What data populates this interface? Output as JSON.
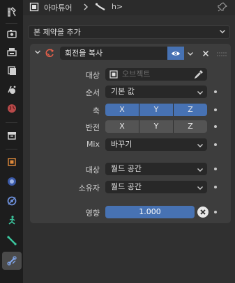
{
  "header": {
    "object_name": "아마튜어",
    "bone_name": "h>"
  },
  "add_constraint": {
    "label": "본 제약을 추가"
  },
  "constraint": {
    "name": "회전을 복사",
    "rows": {
      "target": {
        "label": "대상",
        "placeholder": "오브젝트"
      },
      "order": {
        "label": "순서",
        "value": "기본 값"
      },
      "axis": {
        "label": "축",
        "buttons": [
          "X",
          "Y",
          "Z"
        ]
      },
      "invert": {
        "label": "반전",
        "buttons": [
          "X",
          "Y",
          "Z"
        ]
      },
      "mix": {
        "label": "Mix",
        "value": "바꾸기"
      },
      "target_space": {
        "label": "대상",
        "value": "월드 공간"
      },
      "owner_space": {
        "label": "소유자",
        "value": "월드 공간"
      },
      "influence": {
        "label": "영향",
        "value": "1.000"
      }
    }
  },
  "colors": {
    "accent": "#4772b3",
    "constraint_icon": "#e8604a"
  },
  "tabs": [
    {
      "icon": "tool-icon"
    },
    {
      "icon": "render-icon"
    },
    {
      "icon": "output-icon"
    },
    {
      "icon": "view-layer-icon"
    },
    {
      "icon": "scene-icon"
    },
    {
      "icon": "world-icon"
    },
    {
      "icon": "collection-icon"
    },
    {
      "icon": "object-icon"
    },
    {
      "icon": "modifier-icon"
    },
    {
      "icon": "physics-icon"
    },
    {
      "icon": "object-constraint-icon"
    },
    {
      "icon": "armature-data-icon"
    },
    {
      "icon": "bone-icon"
    },
    {
      "icon": "bone-constraint-icon"
    }
  ]
}
